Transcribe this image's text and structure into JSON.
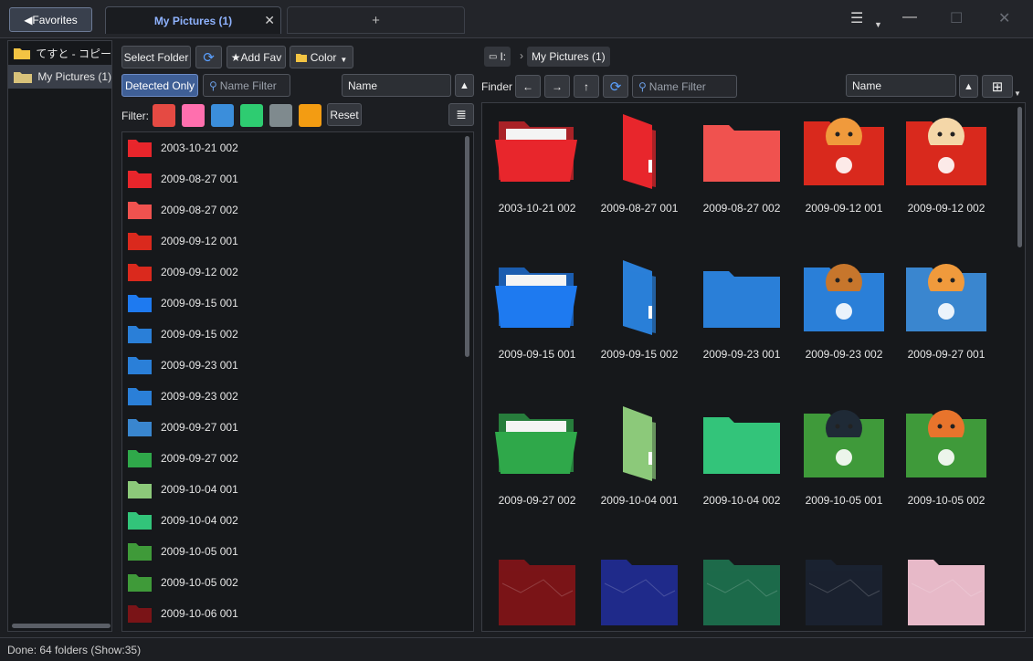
{
  "titlebar": {
    "favorites_label": "◀Favorites",
    "tab_label": "My Pictures (1)",
    "tab_close": "✕",
    "newtab_label": "+",
    "menu_glyph": "☰",
    "minimize_glyph": "—",
    "maximize_glyph": "☐",
    "close_glyph": "✕"
  },
  "favorites": {
    "items": [
      {
        "label": "てすと - コピー"
      },
      {
        "label": "My Pictures (1)"
      }
    ]
  },
  "toolbar": {
    "select_folder": "Select Folder",
    "refresh_glyph": "⟳",
    "add_fav": "★Add Fav",
    "color": "Color",
    "detected_only": "Detected Only",
    "name_filter_placeholder": "Name Filter",
    "sort_value": "Name",
    "sort_dir_glyph": "▲",
    "filter_label": "Filter:",
    "reset": "Reset",
    "list_glyph": "≣",
    "filter_colors": [
      "#e54a43",
      "#ff6fae",
      "#3b8edb",
      "#2ecc71",
      "#7f8a8e",
      "#f39c12"
    ]
  },
  "list_items": [
    {
      "label": "2003-10-21 002",
      "icon": "red-open-folder-icon",
      "color": "#e8262c"
    },
    {
      "label": "2009-08-27 001",
      "icon": "red-side-folder-icon",
      "color": "#e8262c"
    },
    {
      "label": "2009-08-27 002",
      "icon": "red-flat-folder-icon",
      "color": "#f0524f"
    },
    {
      "label": "2009-09-12 001",
      "icon": "red-cat-folder-icon",
      "color": "#d9291d"
    },
    {
      "label": "2009-09-12 002",
      "icon": "red-dog-folder-icon",
      "color": "#d9291d"
    },
    {
      "label": "2009-09-15 001",
      "icon": "blue-open-folder-icon",
      "color": "#1e7af0"
    },
    {
      "label": "2009-09-15 002",
      "icon": "blue-side-folder-icon",
      "color": "#2a7fd8"
    },
    {
      "label": "2009-09-23 001",
      "icon": "blue-flat-folder-icon",
      "color": "#2a7fd8"
    },
    {
      "label": "2009-09-23 002",
      "icon": "blue-bear-folder-icon",
      "color": "#2a7fd8"
    },
    {
      "label": "2009-09-27 001",
      "icon": "blue-cat-folder-icon",
      "color": "#3a86cf"
    },
    {
      "label": "2009-09-27 002",
      "icon": "green-open-folder-icon",
      "color": "#2fa84a"
    },
    {
      "label": "2009-10-04 001",
      "icon": "lightgreen-side-folder-icon",
      "color": "#8cc97a"
    },
    {
      "label": "2009-10-04 002",
      "icon": "green-flat-folder-icon",
      "color": "#33c47a"
    },
    {
      "label": "2009-10-05 001",
      "icon": "green-penguin-folder-icon",
      "color": "#3f9a3a"
    },
    {
      "label": "2009-10-05 002",
      "icon": "green-fox-folder-icon",
      "color": "#3f9a3a"
    },
    {
      "label": "2009-10-06 001",
      "icon": "ruby-folder-icon",
      "color": "#7a1418"
    }
  ],
  "finder": {
    "drive_label": "I:",
    "breadcrumb_sep": "›",
    "path_label": "My Pictures (1)",
    "finder_label": "Finder",
    "back_glyph": "←",
    "forward_glyph": "→",
    "up_glyph": "↑",
    "refresh_glyph": "⟳",
    "name_filter_placeholder": "Name Filter",
    "sort_value": "Name",
    "sort_dir_glyph": "▲",
    "view_glyph": "⊞"
  },
  "grid_items": [
    {
      "label": "2003-10-21 002",
      "kind": "open",
      "color": "#e8262c"
    },
    {
      "label": "2009-08-27 001",
      "kind": "side",
      "color": "#e8262c"
    },
    {
      "label": "2009-08-27 002",
      "kind": "flat",
      "color": "#f0524f"
    },
    {
      "label": "2009-09-12 001",
      "kind": "cat",
      "color": "#d9291d"
    },
    {
      "label": "2009-09-12 002",
      "kind": "dog",
      "color": "#d9291d"
    },
    {
      "label": "2009-09-15 001",
      "kind": "open",
      "color": "#1e7af0"
    },
    {
      "label": "2009-09-15 002",
      "kind": "side",
      "color": "#2a7fd8"
    },
    {
      "label": "2009-09-23 001",
      "kind": "flat",
      "color": "#2a7fd8"
    },
    {
      "label": "2009-09-23 002",
      "kind": "bear",
      "color": "#2a7fd8"
    },
    {
      "label": "2009-09-27 001",
      "kind": "cat",
      "color": "#3a86cf"
    },
    {
      "label": "2009-09-27 002",
      "kind": "open",
      "color": "#2fa84a"
    },
    {
      "label": "2009-10-04 001",
      "kind": "side",
      "color": "#8cc97a"
    },
    {
      "label": "2009-10-04 002",
      "kind": "flat",
      "color": "#33c47a"
    },
    {
      "label": "2009-10-05 001",
      "kind": "penguin",
      "color": "#3f9a3a"
    },
    {
      "label": "2009-10-05 002",
      "kind": "fox",
      "color": "#3f9a3a"
    },
    {
      "label": "",
      "kind": "texture",
      "color": "#7a1418"
    },
    {
      "label": "",
      "kind": "texture",
      "color": "#1f2a8a"
    },
    {
      "label": "",
      "kind": "texture",
      "color": "#1d6a4a"
    },
    {
      "label": "",
      "kind": "texture",
      "color": "#1a2230"
    },
    {
      "label": "",
      "kind": "texture",
      "color": "#e7b9c8"
    }
  ],
  "status": {
    "text": "Done: 64 folders (Show:35)"
  }
}
